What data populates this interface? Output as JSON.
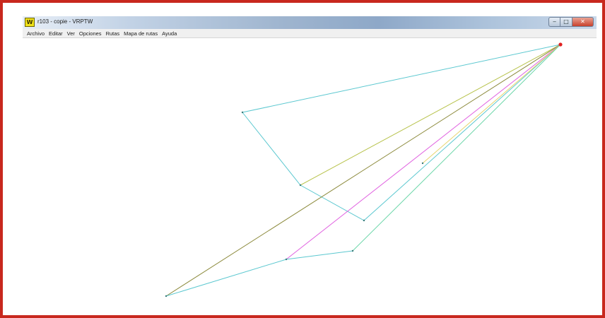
{
  "window": {
    "title": "r103 - copie - VRPTW",
    "icon": "vrptw-app-icon",
    "icon_label": "W",
    "controls": {
      "minimize": "‒",
      "maximize": "□",
      "close": "✕"
    }
  },
  "menu": {
    "items": [
      "Archivo",
      "Editar",
      "Ver",
      "Opciones",
      "Rutas",
      "Mapa de rutas",
      "Ayuda"
    ]
  },
  "frame_color": "#c8281e",
  "depot_color": "#e02020",
  "route_colors": [
    "#5cc8d0",
    "#b7c24a",
    "#8c8a3c",
    "#e060e0",
    "#e6d46a",
    "#6ad6a8"
  ]
}
